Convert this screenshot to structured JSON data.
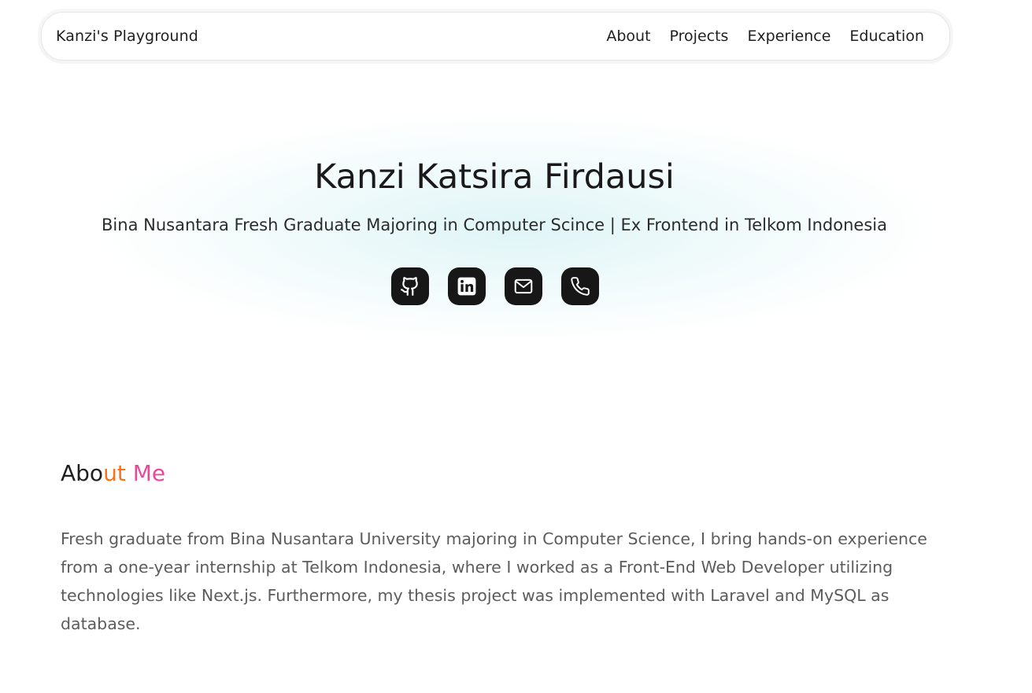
{
  "nav": {
    "brand": "Kanzi's Playground",
    "links": [
      {
        "label": "About"
      },
      {
        "label": "Projects"
      },
      {
        "label": "Experience"
      },
      {
        "label": "Education"
      }
    ]
  },
  "hero": {
    "name": "Kanzi Katsira Firdausi",
    "subtitle": "Bina Nusantara Fresh Graduate Majoring in Computer Scince | Ex Frontend in Telkom Indonesia",
    "socials": [
      {
        "icon": "github-icon"
      },
      {
        "icon": "linkedin-icon"
      },
      {
        "icon": "mail-icon"
      },
      {
        "icon": "phone-icon"
      }
    ]
  },
  "about": {
    "title_parts": [
      "Abo",
      "ut ",
      "Me"
    ],
    "text": "Fresh graduate from Bina Nusantara University majoring in Computer Science, I bring hands-on experience from a one-year internship at Telkom Indonesia, where I worked as a Front-End Web Developer utilizing technologies like Next.js. Furthermore, my thesis project was implemented with Laravel and MySQL as database."
  },
  "colors": {
    "accent_orange": "#f97316",
    "accent_pink": "#ec4899",
    "icon_bg": "#171717"
  }
}
